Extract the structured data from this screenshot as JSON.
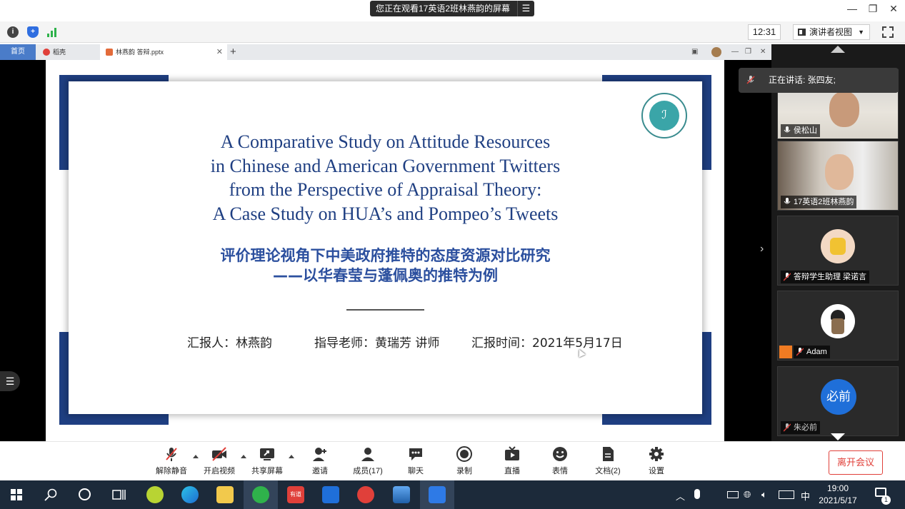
{
  "titlebar": {
    "watching_banner": "您正在观看17英语2班林燕韵的屏幕",
    "menu_icon": "hamburger-icon",
    "window_controls": [
      "minimize-icon",
      "restore-icon",
      "close-icon"
    ]
  },
  "meeting_bar": {
    "clock": "12:31",
    "view_mode": "演讲者视图",
    "icons": [
      "info-icon",
      "shield-icon",
      "signal-icon",
      "fullscreen-icon"
    ]
  },
  "wps": {
    "home_tab": "首页",
    "tabs": [
      {
        "label": "稻壳",
        "color": "#e0403a"
      },
      {
        "label": "林燕韵 答辩.pptx",
        "color": "#e36b3a"
      }
    ]
  },
  "slide": {
    "title_en": [
      "A Comparative Study on Attitude Resources",
      "in Chinese and American Government Twitters",
      "from the Perspective of Appraisal Theory:",
      "A Case Study on HUA’s and Pompeo’s Tweets"
    ],
    "title_cn": [
      "评价理论视角下中美政府推特的态度资源对比研究",
      "——以华春莹与蓬佩奥的推特为例"
    ],
    "reporter": "汇报人：林燕韵",
    "advisor": "指导老师：黄瑞芳 讲师",
    "date": "汇报时间：2021年5月17日",
    "accent_color": "#1f3f82"
  },
  "panel": {
    "speaking": "正在讲话: 张四友;",
    "participants": [
      {
        "name": "侯松山",
        "type": "video"
      },
      {
        "name": "17英语2班林燕韵",
        "type": "video"
      },
      {
        "name": "答辩学生助理 梁诺言",
        "type": "avatar"
      },
      {
        "name": "Adam",
        "type": "avatar"
      },
      {
        "name": "朱必前",
        "type": "initials",
        "initials": "必前"
      }
    ]
  },
  "controls": {
    "items": [
      {
        "label": "解除静音",
        "icon": "mic-muted-icon"
      },
      {
        "label": "开启视频",
        "icon": "camera-off-icon"
      },
      {
        "label": "共享屏幕",
        "icon": "share-screen-icon"
      },
      {
        "label": "邀请",
        "icon": "invite-icon"
      },
      {
        "label": "成员(17)",
        "icon": "members-icon"
      },
      {
        "label": "聊天",
        "icon": "chat-icon"
      },
      {
        "label": "录制",
        "icon": "record-icon"
      },
      {
        "label": "直播",
        "icon": "live-icon"
      },
      {
        "label": "表情",
        "icon": "emoji-icon"
      },
      {
        "label": "文档(2)",
        "icon": "document-icon"
      },
      {
        "label": "设置",
        "icon": "settings-icon"
      }
    ],
    "leave": "离开会议",
    "leave_color": "#e0403a"
  },
  "taskbar": {
    "time": "19:00",
    "date": "2021/5/17",
    "ime": "中",
    "notification_count": "1"
  }
}
